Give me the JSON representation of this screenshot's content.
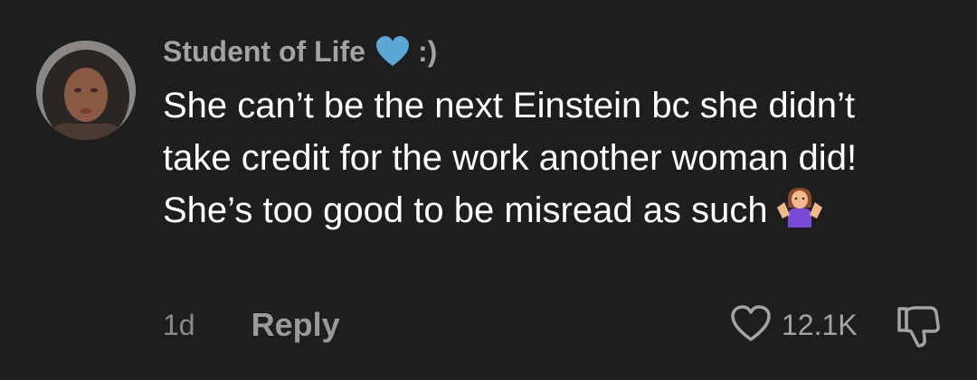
{
  "comment": {
    "username": "Student of Life",
    "username_suffix": ":)",
    "username_emoji": "blue-heart-icon",
    "text": "She can’t be the next Einstein bc she didn’t take credit for the work another woman did! She’s too good to be misread as such",
    "text_emoji": "person-shrugging-icon",
    "timestamp": "1d",
    "reply_label": "Reply",
    "like_count": "12.1K"
  },
  "colors": {
    "background": "#1e1e1e",
    "username": "#a3a3a3",
    "text": "#ffffff",
    "meta": "#8a8a8a",
    "heart_emoji": "#5ba7d6"
  }
}
